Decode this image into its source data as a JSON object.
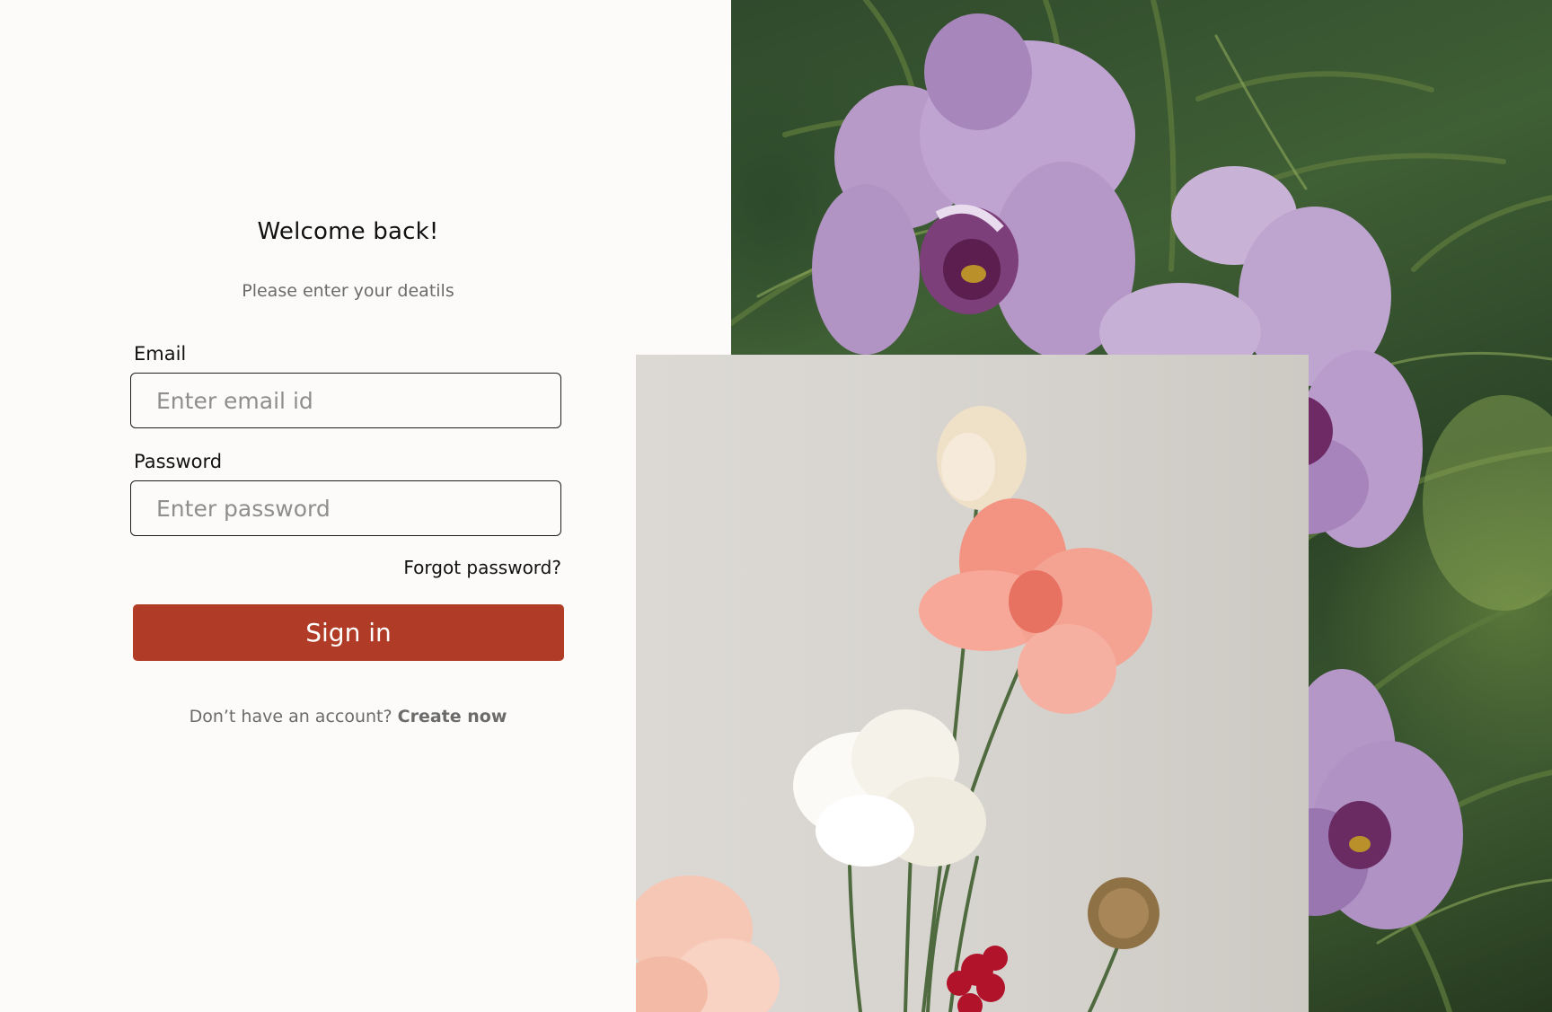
{
  "login": {
    "title": "Welcome back!",
    "subtitle": "Please enter your deatils",
    "email": {
      "label": "Email",
      "placeholder": "Enter email id",
      "value": ""
    },
    "password": {
      "label": "Password",
      "placeholder": "Enter password",
      "value": ""
    },
    "forgot_password": "Forgot password?",
    "sign_in_label": "Sign in",
    "signup_prompt": "Don’t have an account?",
    "create_now": "Create now"
  },
  "colors": {
    "background": "#fcfbfa",
    "accent": "#b03b26",
    "muted_text": "#6b6b6b"
  },
  "images": {
    "background_photo": "purple-orchid-photo",
    "foreground_photo": "flower-stems-photo"
  }
}
